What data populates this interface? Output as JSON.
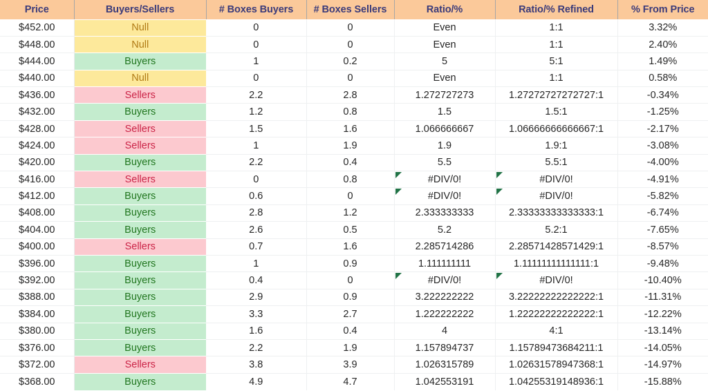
{
  "table": {
    "columns": [
      {
        "key": "price",
        "label": "Price"
      },
      {
        "key": "status",
        "label": "Buyers/Sellers"
      },
      {
        "key": "bbuy",
        "label": "# Boxes Buyers"
      },
      {
        "key": "bsell",
        "label": "# Boxes Sellers"
      },
      {
        "key": "ratio",
        "label": "Ratio/%"
      },
      {
        "key": "refined",
        "label": "Ratio/% Refined"
      },
      {
        "key": "pct",
        "label": "% From Price"
      }
    ],
    "colors": {
      "header_bg": "#fbc99a",
      "header_text": "#3b3b7a",
      "null_bg": "#fde99b",
      "null_text": "#b07a14",
      "buyers_bg": "#c4ecce",
      "buyers_text": "#21761f",
      "sellers_bg": "#fcc9cf",
      "sellers_text": "#cb2447",
      "error_marker": "#217346",
      "gridline": "#eef0f1"
    },
    "rows": [
      {
        "price": "$452.00",
        "status": "Null",
        "bbuy": "0",
        "bsell": "0",
        "ratio": "Even",
        "refined": "1:1",
        "pct": "3.32%",
        "error": false
      },
      {
        "price": "$448.00",
        "status": "Null",
        "bbuy": "0",
        "bsell": "0",
        "ratio": "Even",
        "refined": "1:1",
        "pct": "2.40%",
        "error": false
      },
      {
        "price": "$444.00",
        "status": "Buyers",
        "bbuy": "1",
        "bsell": "0.2",
        "ratio": "5",
        "refined": "5:1",
        "pct": "1.49%",
        "error": false
      },
      {
        "price": "$440.00",
        "status": "Null",
        "bbuy": "0",
        "bsell": "0",
        "ratio": "Even",
        "refined": "1:1",
        "pct": "0.58%",
        "error": false
      },
      {
        "price": "$436.00",
        "status": "Sellers",
        "bbuy": "2.2",
        "bsell": "2.8",
        "ratio": "1.272727273",
        "refined": "1.27272727272727:1",
        "pct": "-0.34%",
        "error": false
      },
      {
        "price": "$432.00",
        "status": "Buyers",
        "bbuy": "1.2",
        "bsell": "0.8",
        "ratio": "1.5",
        "refined": "1.5:1",
        "pct": "-1.25%",
        "error": false
      },
      {
        "price": "$428.00",
        "status": "Sellers",
        "bbuy": "1.5",
        "bsell": "1.6",
        "ratio": "1.066666667",
        "refined": "1.06666666666667:1",
        "pct": "-2.17%",
        "error": false
      },
      {
        "price": "$424.00",
        "status": "Sellers",
        "bbuy": "1",
        "bsell": "1.9",
        "ratio": "1.9",
        "refined": "1.9:1",
        "pct": "-3.08%",
        "error": false
      },
      {
        "price": "$420.00",
        "status": "Buyers",
        "bbuy": "2.2",
        "bsell": "0.4",
        "ratio": "5.5",
        "refined": "5.5:1",
        "pct": "-4.00%",
        "error": false
      },
      {
        "price": "$416.00",
        "status": "Sellers",
        "bbuy": "0",
        "bsell": "0.8",
        "ratio": "#DIV/0!",
        "refined": "#DIV/0!",
        "pct": "-4.91%",
        "error": true
      },
      {
        "price": "$412.00",
        "status": "Buyers",
        "bbuy": "0.6",
        "bsell": "0",
        "ratio": "#DIV/0!",
        "refined": "#DIV/0!",
        "pct": "-5.82%",
        "error": true
      },
      {
        "price": "$408.00",
        "status": "Buyers",
        "bbuy": "2.8",
        "bsell": "1.2",
        "ratio": "2.333333333",
        "refined": "2.33333333333333:1",
        "pct": "-6.74%",
        "error": false
      },
      {
        "price": "$404.00",
        "status": "Buyers",
        "bbuy": "2.6",
        "bsell": "0.5",
        "ratio": "5.2",
        "refined": "5.2:1",
        "pct": "-7.65%",
        "error": false
      },
      {
        "price": "$400.00",
        "status": "Sellers",
        "bbuy": "0.7",
        "bsell": "1.6",
        "ratio": "2.285714286",
        "refined": "2.28571428571429:1",
        "pct": "-8.57%",
        "error": false
      },
      {
        "price": "$396.00",
        "status": "Buyers",
        "bbuy": "1",
        "bsell": "0.9",
        "ratio": "1.111111111",
        "refined": "1.11111111111111:1",
        "pct": "-9.48%",
        "error": false
      },
      {
        "price": "$392.00",
        "status": "Buyers",
        "bbuy": "0.4",
        "bsell": "0",
        "ratio": "#DIV/0!",
        "refined": "#DIV/0!",
        "pct": "-10.40%",
        "error": true
      },
      {
        "price": "$388.00",
        "status": "Buyers",
        "bbuy": "2.9",
        "bsell": "0.9",
        "ratio": "3.222222222",
        "refined": "3.22222222222222:1",
        "pct": "-11.31%",
        "error": false
      },
      {
        "price": "$384.00",
        "status": "Buyers",
        "bbuy": "3.3",
        "bsell": "2.7",
        "ratio": "1.222222222",
        "refined": "1.22222222222222:1",
        "pct": "-12.22%",
        "error": false
      },
      {
        "price": "$380.00",
        "status": "Buyers",
        "bbuy": "1.6",
        "bsell": "0.4",
        "ratio": "4",
        "refined": "4:1",
        "pct": "-13.14%",
        "error": false
      },
      {
        "price": "$376.00",
        "status": "Buyers",
        "bbuy": "2.2",
        "bsell": "1.9",
        "ratio": "1.157894737",
        "refined": "1.15789473684211:1",
        "pct": "-14.05%",
        "error": false
      },
      {
        "price": "$372.00",
        "status": "Sellers",
        "bbuy": "3.8",
        "bsell": "3.9",
        "ratio": "1.026315789",
        "refined": "1.02631578947368:1",
        "pct": "-14.97%",
        "error": false
      },
      {
        "price": "$368.00",
        "status": "Buyers",
        "bbuy": "4.9",
        "bsell": "4.7",
        "ratio": "1.042553191",
        "refined": "1.04255319148936:1",
        "pct": "-15.88%",
        "error": false
      }
    ]
  }
}
